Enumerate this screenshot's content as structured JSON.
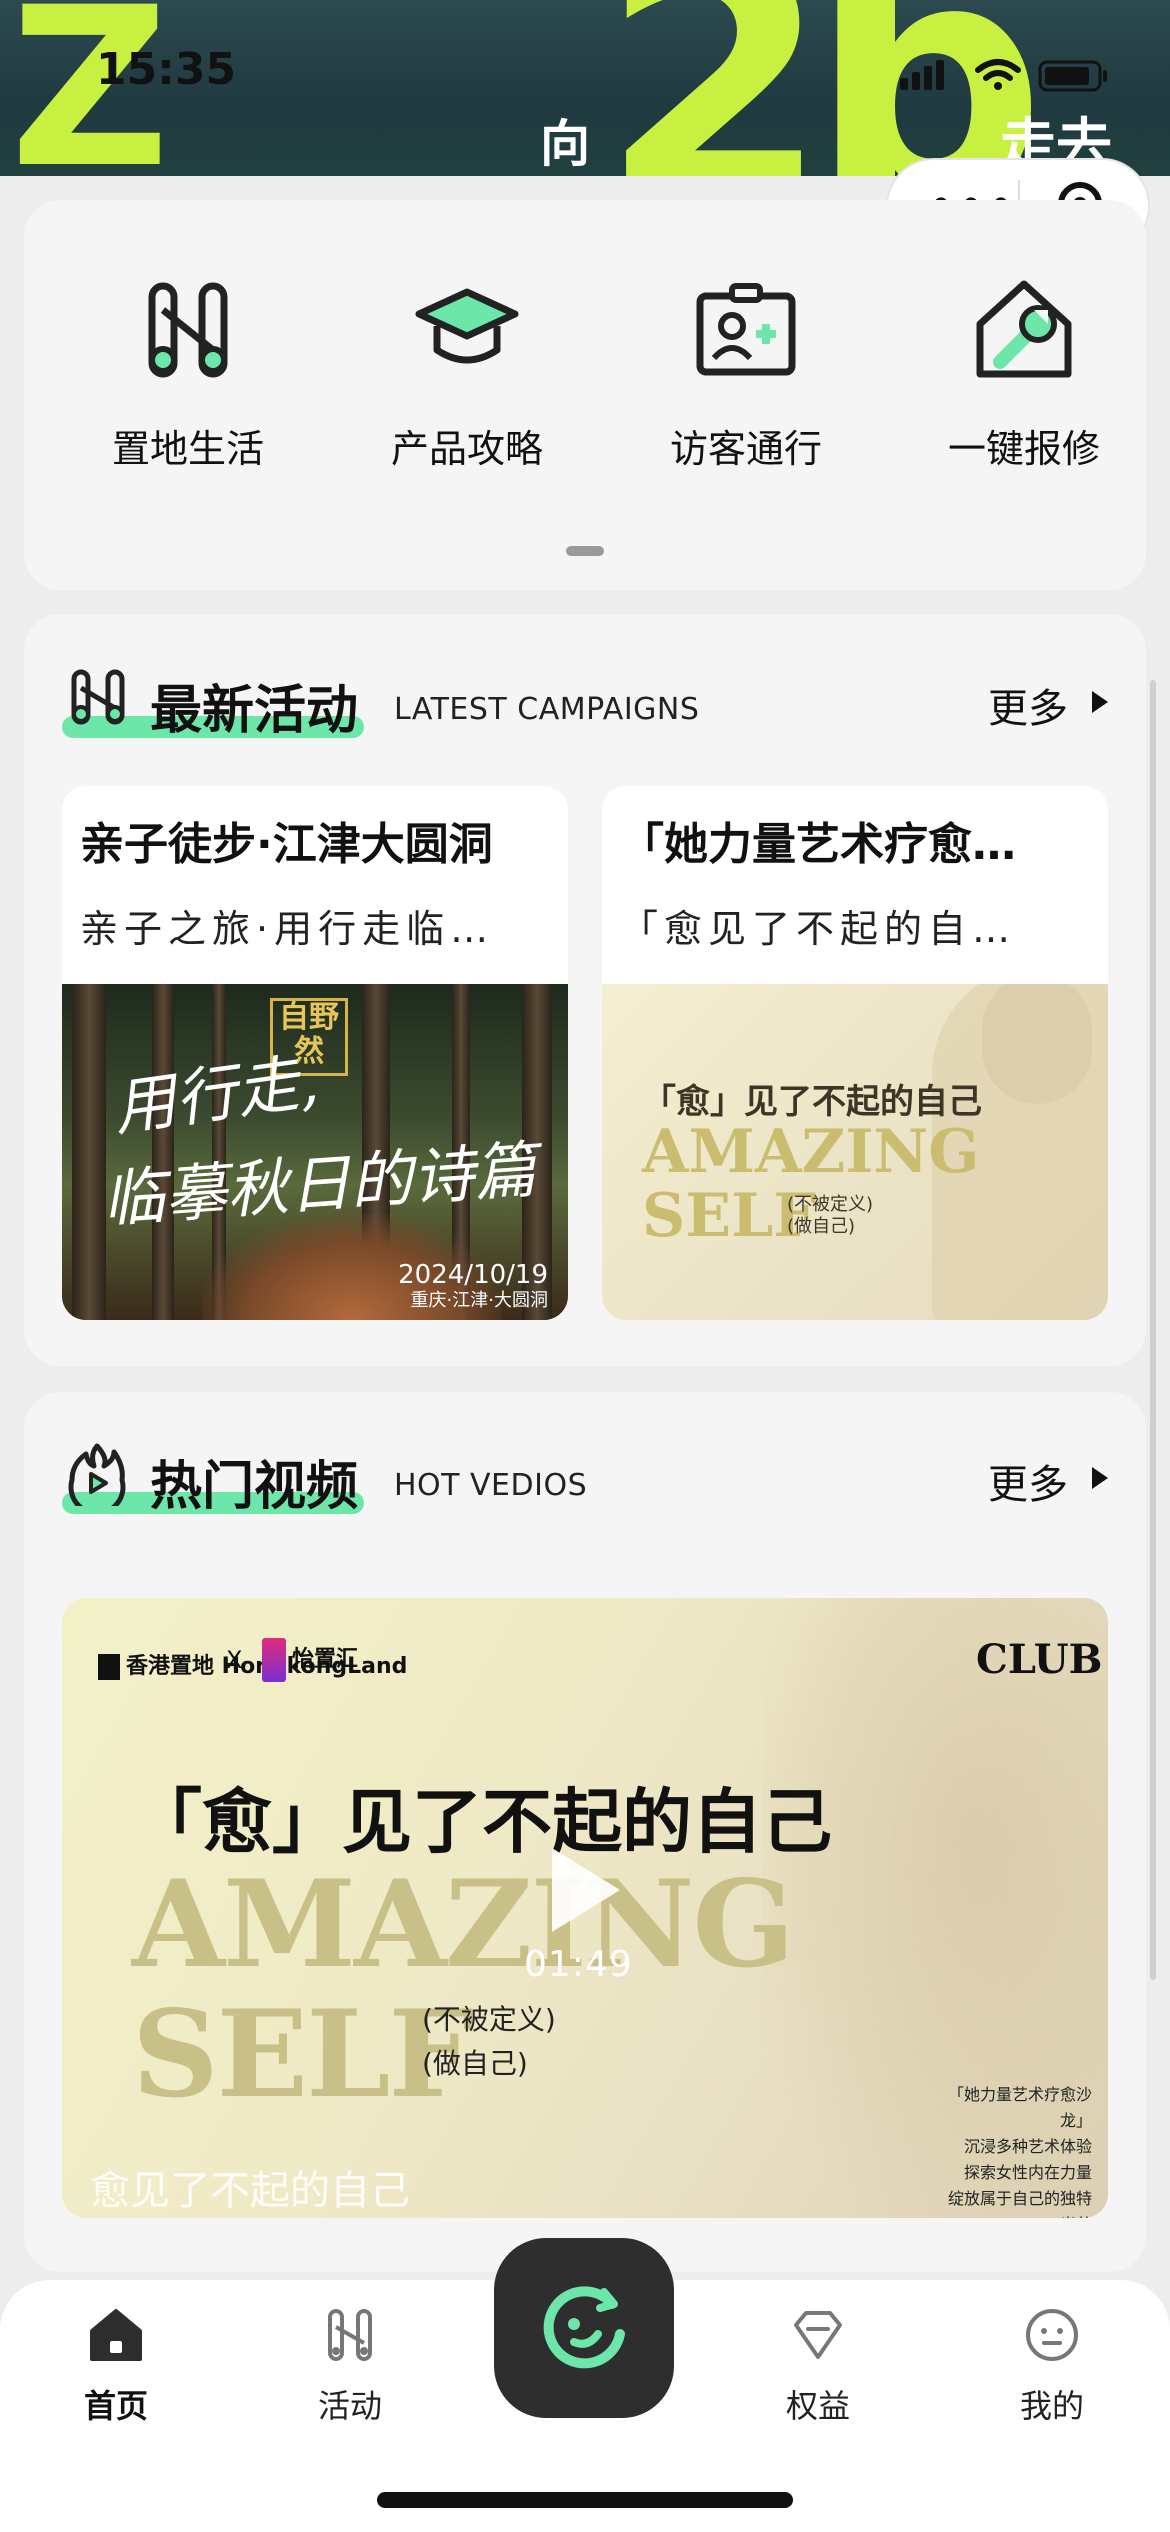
{
  "status_bar": {
    "time": "15:35"
  },
  "banner": {
    "text_left": "向",
    "text_right": "走去"
  },
  "capsule": {
    "more_label": "•••"
  },
  "quick_actions": [
    {
      "label": "置地生活",
      "icon": "brand-h-icon"
    },
    {
      "label": "产品攻略",
      "icon": "graduation-cap-icon"
    },
    {
      "label": "访客通行",
      "icon": "visitor-pass-icon"
    },
    {
      "label": "一键报修",
      "icon": "repair-wrench-icon"
    }
  ],
  "campaigns": {
    "title": "最新活动",
    "subtitle": "LATEST CAMPAIGNS",
    "more": "更多",
    "items": [
      {
        "title": "亲子徒步·江津大圆洞",
        "desc": "亲子之旅·用行走临…",
        "image": {
          "line1": "用行走,",
          "line2": "临摹秋日的诗篇",
          "stamp": "自野然",
          "date": "2024/10/19",
          "place": "重庆·江津·大圆洞"
        }
      },
      {
        "title": "「她力量艺术疗愈…",
        "desc": "「愈见了不起的自…",
        "image": {
          "line1": "「愈」见了不起的自己",
          "big1": "AMAZING",
          "big2": "SELF",
          "paren1": "(不被定义)",
          "paren2": "(做自己)"
        }
      }
    ]
  },
  "videos": {
    "title": "热门视频",
    "subtitle": "HOT VEDIOS",
    "more": "更多",
    "item": {
      "brand1": "香港置地 HongkongLand",
      "cross": "X",
      "brand2": "怡置汇",
      "club": "CLUB",
      "line1": "「愈」见了不起的自己",
      "big1": "AMAZING",
      "big2": "SELF",
      "paren1": "(不被定义)",
      "paren2": "(做自己)",
      "notes": [
        "「她力量艺术疗愈沙龙」",
        "沉浸多种艺术体验",
        "探索女性内在力量",
        "绽放属于自己的独特光芒"
      ],
      "duration": "01:49",
      "caption": "愈见了不起的自己"
    }
  },
  "tabbar": {
    "tabs": [
      {
        "label": "首页",
        "icon": "home-icon",
        "active": true
      },
      {
        "label": "活动",
        "icon": "activity-icon",
        "active": false
      },
      {
        "label": "权益",
        "icon": "diamond-icon",
        "active": false
      },
      {
        "label": "我的",
        "icon": "profile-icon",
        "active": false
      }
    ]
  },
  "colors": {
    "accent": "#6ce6a9",
    "banner_lime": "#c8f041",
    "dark": "#2e2e2e"
  }
}
